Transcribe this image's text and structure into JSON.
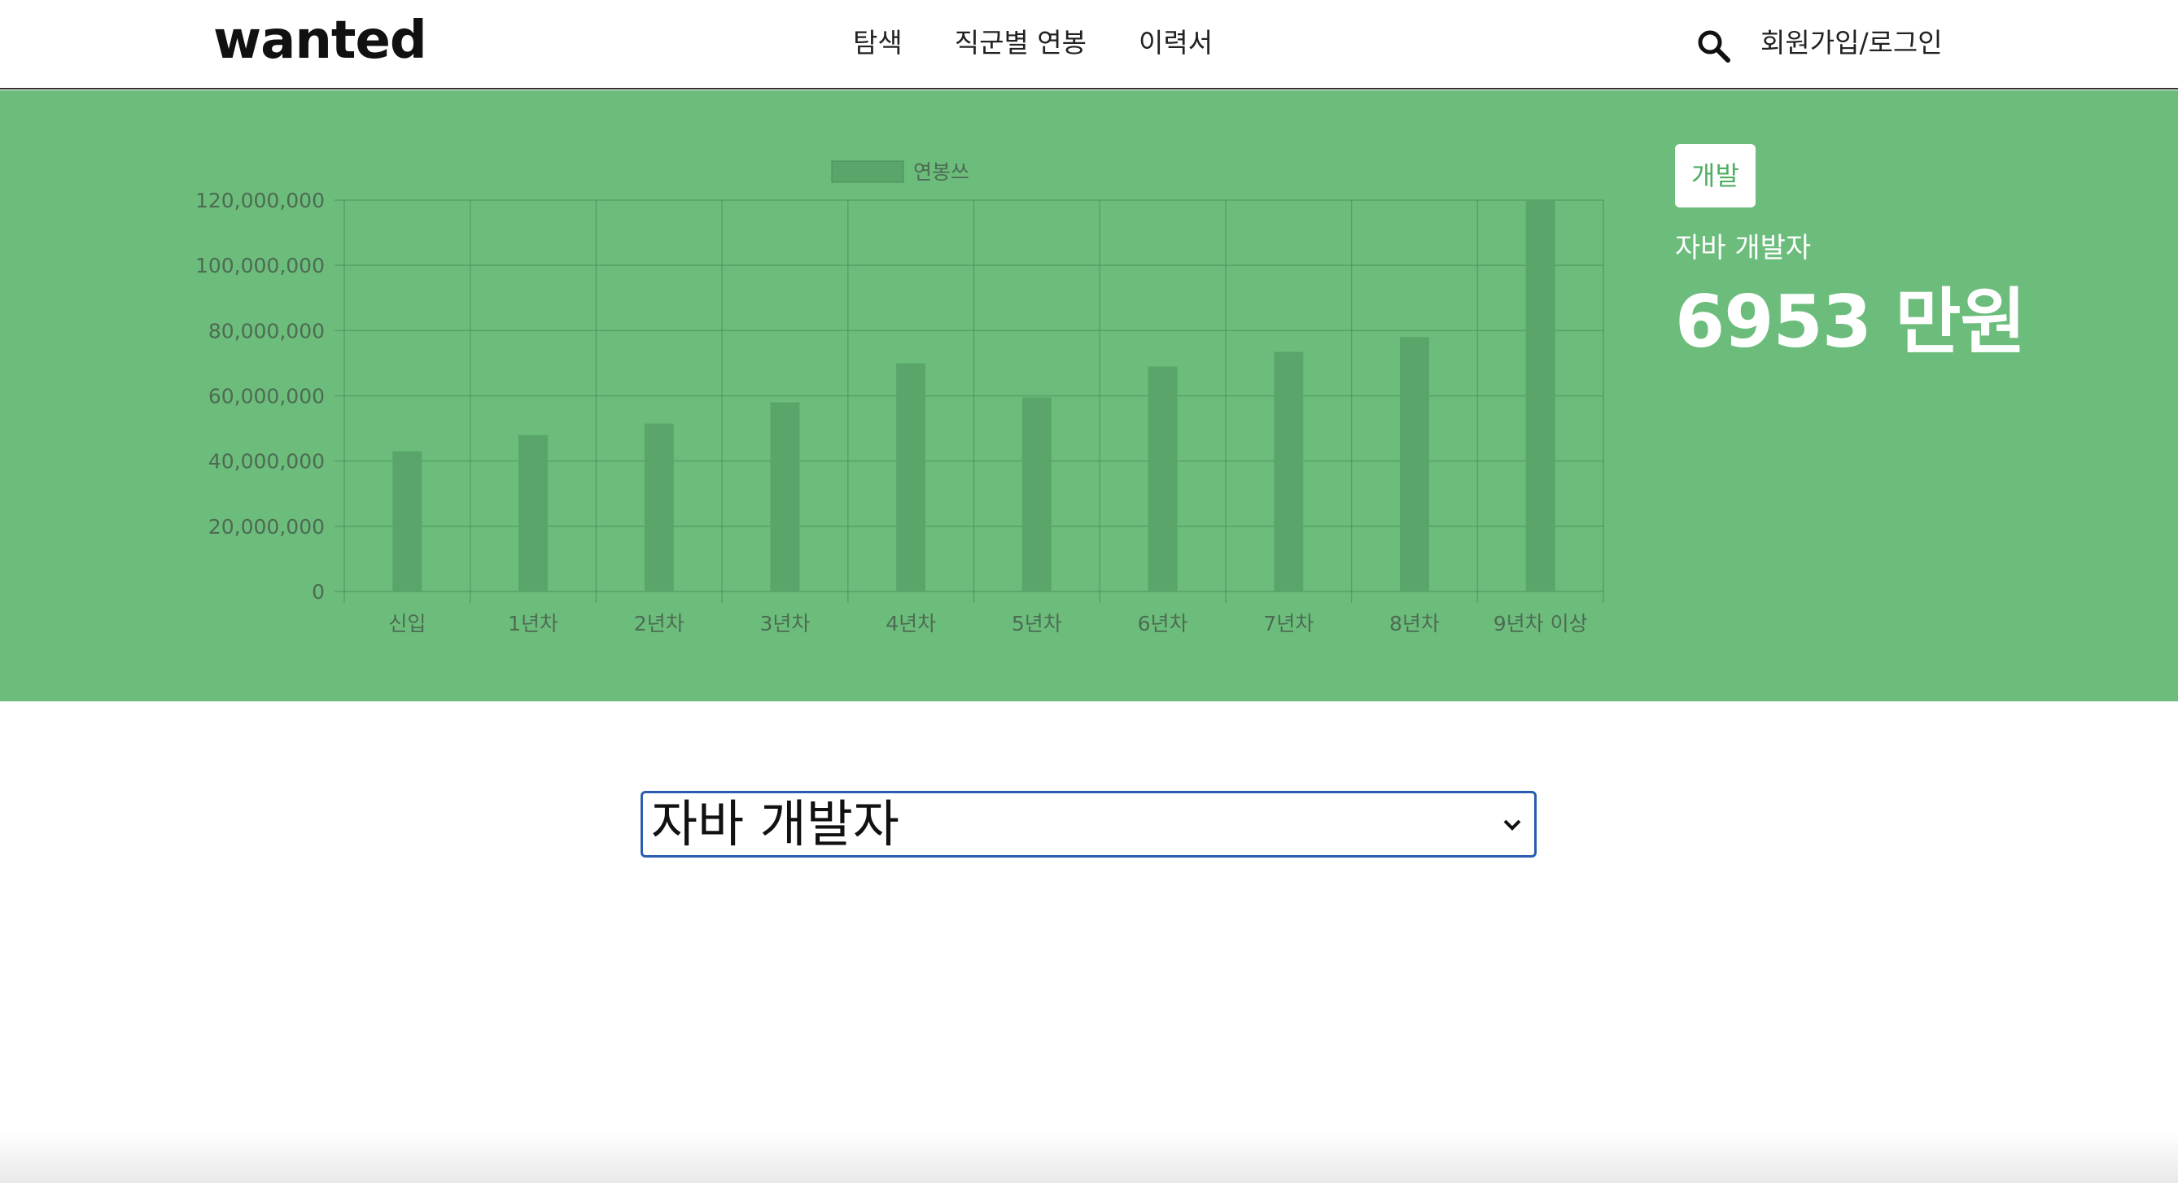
{
  "header": {
    "logo": "wanted",
    "nav": [
      "탐색",
      "직군별 연봉",
      "이력서"
    ],
    "login_label": "회원가입/로그인"
  },
  "side": {
    "category": "개발",
    "job_title": "자바 개발자",
    "salary": "6953 만원"
  },
  "select": {
    "value": "자바 개발자"
  },
  "colors": {
    "hero_bg": "#6cbd7c",
    "bar": "#5aa66a",
    "accent": "#4fae62"
  },
  "chart_data": {
    "type": "bar",
    "legend": "연봉쓰",
    "categories": [
      "신입",
      "1년차",
      "2년차",
      "3년차",
      "4년차",
      "5년차",
      "6년차",
      "7년차",
      "8년차",
      "9년차 이상"
    ],
    "values": [
      43000000,
      48000000,
      51500000,
      58000000,
      70000000,
      59500000,
      69000000,
      73500000,
      78000000,
      120000000
    ],
    "ylim": [
      0,
      120000000
    ],
    "yticks": [
      "0",
      "20,000,000",
      "40,000,000",
      "60,000,000",
      "80,000,000",
      "100,000,000",
      "120,000,000"
    ],
    "grid": true,
    "legend_position": "top"
  }
}
